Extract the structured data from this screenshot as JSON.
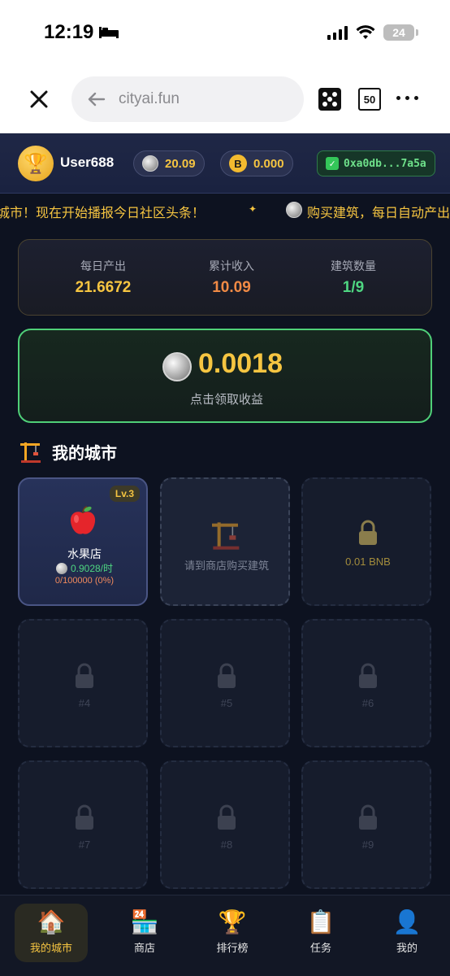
{
  "status_bar": {
    "time": "12:19",
    "battery": "24"
  },
  "browser": {
    "url": "cityai.fun",
    "tab_count": "50"
  },
  "header": {
    "username": "User688",
    "coin_balance": "20.09",
    "bnb_balance": "0.000",
    "wallet": "0xa0db...7a5a"
  },
  "ticker": {
    "text1": "城市！现在开始播报今日社区头条！",
    "text2": "购买建筑，每日自动产出"
  },
  "stats": [
    {
      "label": "每日产出",
      "value": "21.6672",
      "color": "#f6c541"
    },
    {
      "label": "累计收入",
      "value": "10.09",
      "color": "#f08a45"
    },
    {
      "label": "建筑数量",
      "value": "1/9",
      "color": "#4ed681"
    }
  ],
  "claim": {
    "amount": "0.0018",
    "hint": "点击领取收益"
  },
  "section_title": "我的城市",
  "cells": {
    "c1": {
      "level": "Lv.3",
      "name": "水果店",
      "rate": "0.9028/时",
      "progress": "0/100000 (0%)"
    },
    "c2": {
      "label": "请到商店购买建筑"
    },
    "c3": {
      "label": "0.01 BNB"
    },
    "c4": {
      "label": "#4"
    },
    "c5": {
      "label": "#5"
    },
    "c6": {
      "label": "#6"
    },
    "c7": {
      "label": "#7"
    },
    "c8": {
      "label": "#8"
    },
    "c9": {
      "label": "#9"
    }
  },
  "nav": [
    {
      "label": "我的城市",
      "icon": "house-icon"
    },
    {
      "label": "商店",
      "icon": "store-icon"
    },
    {
      "label": "排行榜",
      "icon": "trophy-icon"
    },
    {
      "label": "任务",
      "icon": "clipboard-icon"
    },
    {
      "label": "我的",
      "icon": "user-icon"
    }
  ],
  "colors": {
    "accent": "#f6c541",
    "green": "#4ed681",
    "bg": "#0d1220"
  }
}
